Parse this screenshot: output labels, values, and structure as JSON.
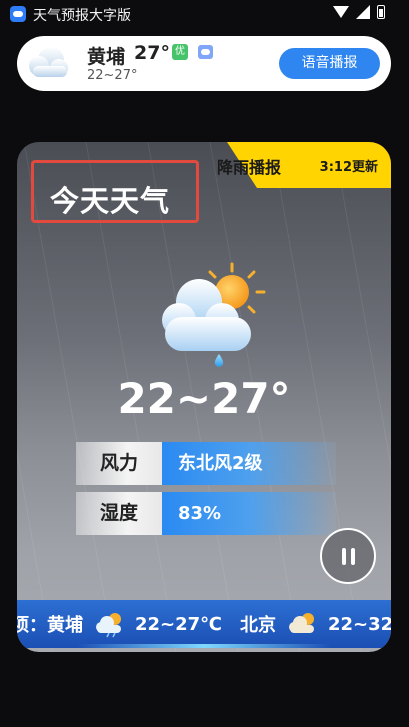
{
  "status_bar": {
    "app_title": "天气预报大字版"
  },
  "location_card": {
    "city": "黄埔",
    "temp": "27°",
    "aqi": "优",
    "range": "22~27°",
    "voice_button": "语音播报"
  },
  "main_card": {
    "banner_label": "降雨播报",
    "update_time": "3:12更新",
    "title": "今天天气",
    "temp_range": "22~27°",
    "wind_label": "风力",
    "wind_value": "东北风2级",
    "humidity_label": "湿度",
    "humidity_value": "83%",
    "ticker": [
      {
        "prefix": "项：",
        "city": "黄埔",
        "range": "22~27℃",
        "icon": "cloud-rain-sun-icon"
      },
      {
        "prefix": "",
        "city": "北京",
        "range": "22~32",
        "icon": "cloud-sun-icon"
      }
    ]
  },
  "colors": {
    "accent_blue": "#2f86f1",
    "banner_yellow": "#ffd400",
    "highlight_red": "#e24a3e",
    "aqi_green": "#47c46b"
  }
}
